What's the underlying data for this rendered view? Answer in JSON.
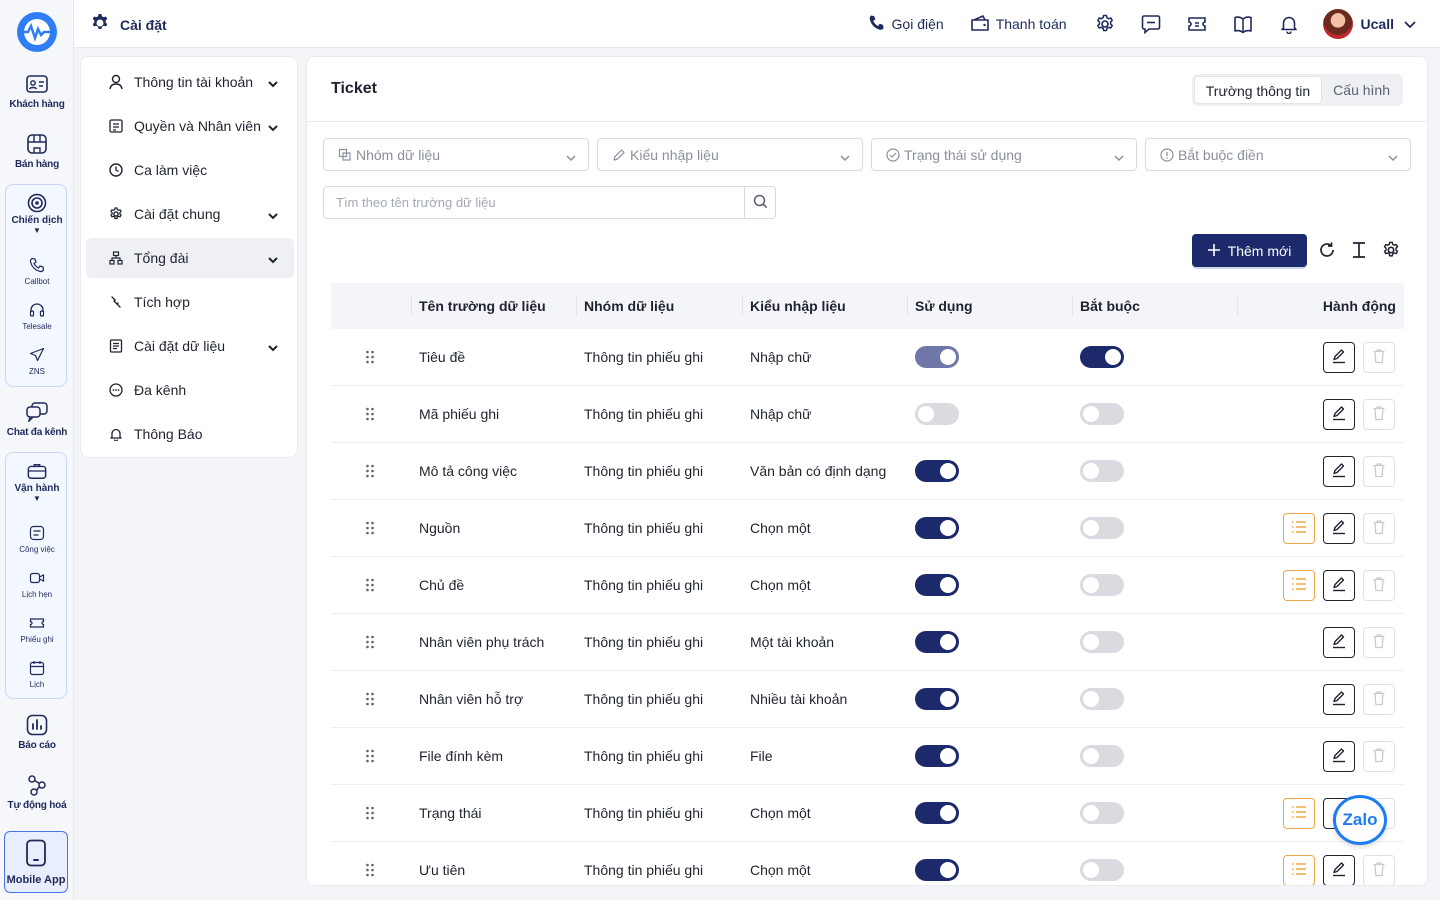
{
  "header": {
    "title": "Cài đặt",
    "call_label": "Gọi điện",
    "payment_label": "Thanh toán",
    "user_name": "Ucall"
  },
  "rail": {
    "items": [
      {
        "label": "Khách hàng"
      },
      {
        "label": "Bán hàng"
      },
      {
        "label": "Chiến dịch"
      },
      {
        "label": "Chat đa kênh"
      },
      {
        "label": "Vận hành"
      },
      {
        "label": "Báo cáo"
      },
      {
        "label": "Tự động hoá"
      },
      {
        "label": "Mobile App"
      }
    ],
    "campaign_sub": [
      {
        "label": "Callbot"
      },
      {
        "label": "Telesale"
      },
      {
        "label": "ZNS"
      }
    ],
    "ops_sub": [
      {
        "label": "Công việc"
      },
      {
        "label": "Lịch hẹn"
      },
      {
        "label": "Phiếu ghi"
      },
      {
        "label": "Lịch"
      }
    ]
  },
  "menu": {
    "items": [
      {
        "label": "Thông tin tài khoản"
      },
      {
        "label": "Quyền và Nhân viên"
      },
      {
        "label": "Ca làm việc"
      },
      {
        "label": "Cài đặt chung"
      },
      {
        "label": "Tổng đài"
      },
      {
        "label": "Tích hợp"
      },
      {
        "label": "Cài đặt dữ liệu"
      },
      {
        "label": "Đa kênh"
      },
      {
        "label": "Thông Báo"
      }
    ]
  },
  "panel": {
    "title": "Ticket",
    "tabs": [
      {
        "label": "Trường thông tin"
      },
      {
        "label": "Cấu hình"
      }
    ],
    "filters": [
      {
        "placeholder": "Nhóm dữ liệu"
      },
      {
        "placeholder": "Kiểu nhập liệu"
      },
      {
        "placeholder": "Trạng thái sử dụng"
      },
      {
        "placeholder": "Bắt buộc điền"
      }
    ],
    "search_placeholder": "Tìm theo tên trường dữ liệu",
    "add_label": "Thêm mới"
  },
  "table": {
    "columns": [
      "Tên trường dữ liệu",
      "Nhóm dữ liệu",
      "Kiểu nhập liệu",
      "Sử dụng",
      "Bắt buộc",
      "Hành động"
    ],
    "rows": [
      {
        "name": "Tiêu đề",
        "group": "Thông tin phiếu ghi",
        "type": "Nhập chữ",
        "used": "soft",
        "required": "on",
        "options": false
      },
      {
        "name": "Mã phiếu ghi",
        "group": "Thông tin phiếu ghi",
        "type": "Nhập chữ",
        "used": "off",
        "required": "off",
        "options": false
      },
      {
        "name": "Mô tả công việc",
        "group": "Thông tin phiếu ghi",
        "type": "Văn bản có định dạng",
        "used": "on",
        "required": "off",
        "options": false
      },
      {
        "name": "Nguồn",
        "group": "Thông tin phiếu ghi",
        "type": "Chọn một",
        "used": "on",
        "required": "off",
        "options": true
      },
      {
        "name": "Chủ đề",
        "group": "Thông tin phiếu ghi",
        "type": "Chọn một",
        "used": "on",
        "required": "off",
        "options": true
      },
      {
        "name": "Nhân viên phụ trách",
        "group": "Thông tin phiếu ghi",
        "type": "Một tài khoản",
        "used": "on",
        "required": "off",
        "options": false
      },
      {
        "name": "Nhân viên hỗ trợ",
        "group": "Thông tin phiếu ghi",
        "type": "Nhiều tài khoản",
        "used": "on",
        "required": "off",
        "options": false
      },
      {
        "name": "File đính kèm",
        "group": "Thông tin phiếu ghi",
        "type": "File",
        "used": "on",
        "required": "off",
        "options": false
      },
      {
        "name": "Trạng thái",
        "group": "Thông tin phiếu ghi",
        "type": "Chọn một",
        "used": "on",
        "required": "off",
        "options": true
      },
      {
        "name": "Ưu tiên",
        "group": "Thông tin phiếu ghi",
        "type": "Chọn một",
        "used": "on",
        "required": "off",
        "options": true
      }
    ]
  },
  "zalo_label": "Zalo",
  "colors": {
    "primary": "#1c2a6b",
    "accent": "#f0a64a",
    "zalo": "#1f7cf0"
  }
}
